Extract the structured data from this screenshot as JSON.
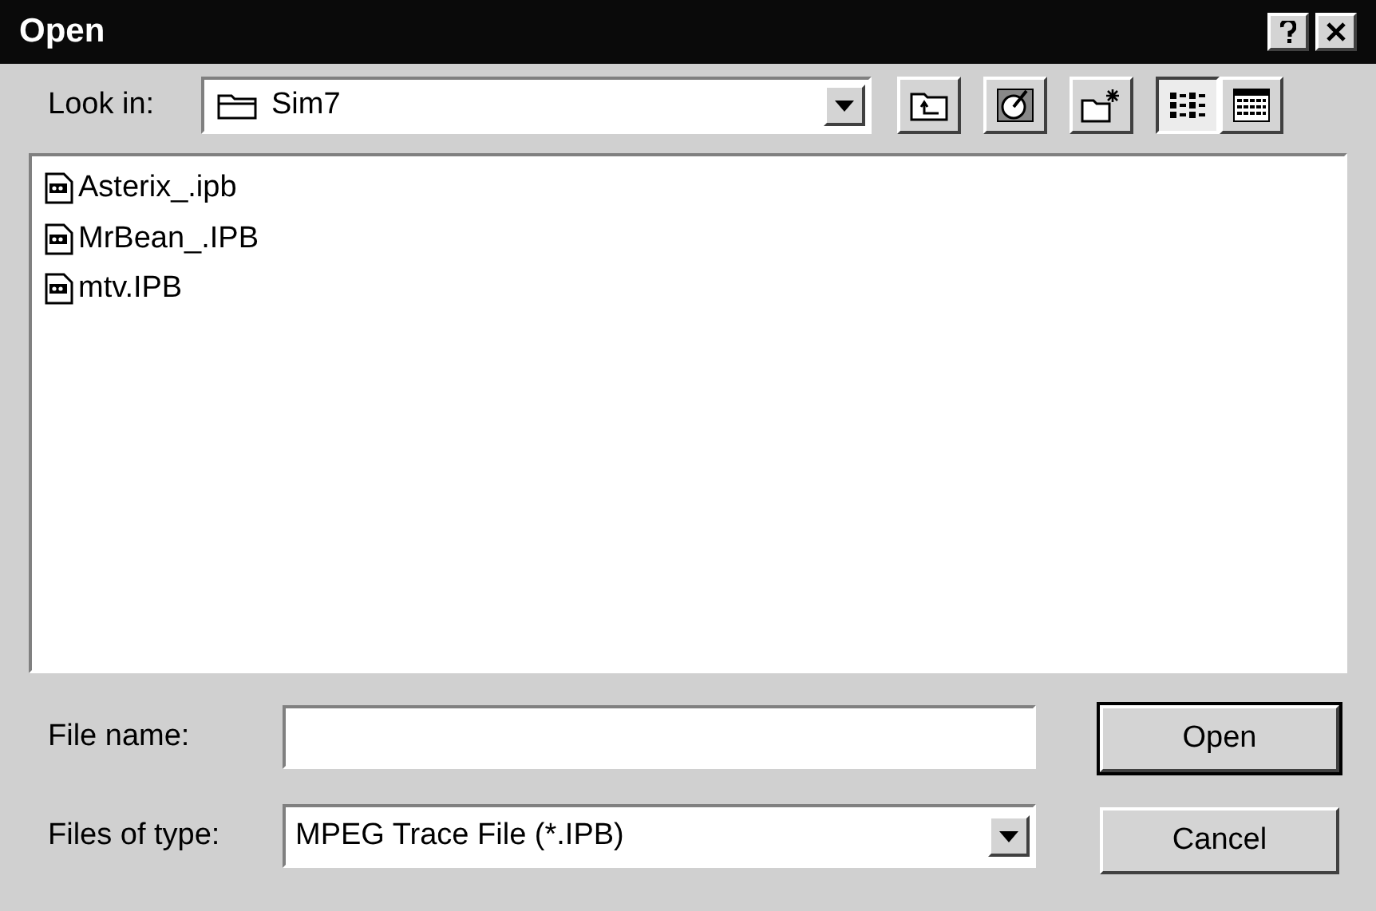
{
  "window": {
    "title": "Open"
  },
  "look_in": {
    "label": "Look in:",
    "value": "Sim7"
  },
  "files": [
    {
      "name": "Asterix_.ipb",
      "selected": false
    },
    {
      "name": "MrBean_.IPB",
      "selected": false
    },
    {
      "name": "mtv.IPB",
      "selected": false
    }
  ],
  "view_mode": {
    "list_selected": true,
    "details_selected": false
  },
  "file_name": {
    "label": "File name:"
  },
  "file_type": {
    "label": "Files of type:",
    "value": "MPEG Trace File (*.IPB)"
  },
  "buttons": [
    {
      "label": "Open",
      "default": true
    },
    {
      "label": "Cancel",
      "default": false
    }
  ]
}
